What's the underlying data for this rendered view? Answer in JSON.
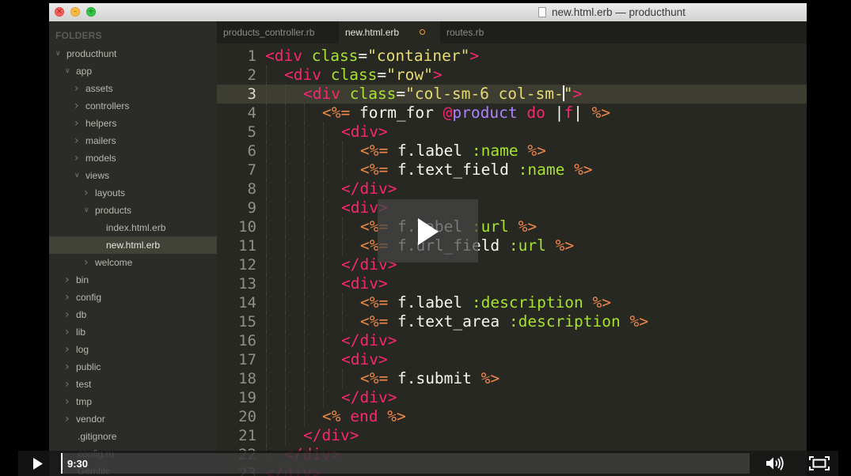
{
  "window": {
    "title": "new.html.erb — producthunt",
    "lights": [
      "×",
      "–",
      "+"
    ]
  },
  "sidebar": {
    "header": "FOLDERS",
    "items": [
      {
        "label": "producthunt",
        "depth": 0,
        "expander": "open"
      },
      {
        "label": "app",
        "depth": 1,
        "expander": "open"
      },
      {
        "label": "assets",
        "depth": 2,
        "expander": "closed"
      },
      {
        "label": "controllers",
        "depth": 2,
        "expander": "closed"
      },
      {
        "label": "helpers",
        "depth": 2,
        "expander": "closed"
      },
      {
        "label": "mailers",
        "depth": 2,
        "expander": "closed"
      },
      {
        "label": "models",
        "depth": 2,
        "expander": "closed"
      },
      {
        "label": "views",
        "depth": 2,
        "expander": "open"
      },
      {
        "label": "layouts",
        "depth": 3,
        "expander": "closed"
      },
      {
        "label": "products",
        "depth": 3,
        "expander": "open"
      },
      {
        "label": "index.html.erb",
        "depth": 4,
        "expander": "none"
      },
      {
        "label": "new.html.erb",
        "depth": 4,
        "expander": "none",
        "selected": true
      },
      {
        "label": "welcome",
        "depth": 3,
        "expander": "closed"
      },
      {
        "label": "bin",
        "depth": 1,
        "expander": "closed"
      },
      {
        "label": "config",
        "depth": 1,
        "expander": "closed"
      },
      {
        "label": "db",
        "depth": 1,
        "expander": "closed"
      },
      {
        "label": "lib",
        "depth": 1,
        "expander": "closed"
      },
      {
        "label": "log",
        "depth": 1,
        "expander": "closed"
      },
      {
        "label": "public",
        "depth": 1,
        "expander": "closed"
      },
      {
        "label": "test",
        "depth": 1,
        "expander": "closed"
      },
      {
        "label": "tmp",
        "depth": 1,
        "expander": "closed"
      },
      {
        "label": "vendor",
        "depth": 1,
        "expander": "closed"
      },
      {
        "label": ".gitignore",
        "depth": 1,
        "expander": "none"
      },
      {
        "label": "config.ru",
        "depth": 1,
        "expander": "none"
      },
      {
        "label": "Gemfile",
        "depth": 1,
        "expander": "none"
      }
    ]
  },
  "tabs": [
    {
      "label": "products_controller.rb",
      "active": false,
      "dirty": false
    },
    {
      "label": "new.html.erb",
      "active": true,
      "dirty": true
    },
    {
      "label": "routes.rb",
      "active": false,
      "dirty": false
    }
  ],
  "editor": {
    "current_line": 3,
    "cursor_line": 3,
    "lines": [
      {
        "n": "1",
        "indent": 0,
        "tokens": [
          [
            "t-tag",
            "<div"
          ],
          [
            "t-plain",
            " "
          ],
          [
            "t-attr",
            "class"
          ],
          [
            "t-plain",
            "="
          ],
          [
            "t-str",
            "\"container\""
          ],
          [
            "t-tag",
            ">"
          ]
        ]
      },
      {
        "n": "2",
        "indent": 1,
        "tokens": [
          [
            "t-tag",
            "<div"
          ],
          [
            "t-plain",
            " "
          ],
          [
            "t-attr",
            "class"
          ],
          [
            "t-plain",
            "="
          ],
          [
            "t-str",
            "\"row\""
          ],
          [
            "t-tag",
            ">"
          ]
        ]
      },
      {
        "n": "3",
        "indent": 2,
        "tokens": [
          [
            "t-tag",
            "<div"
          ],
          [
            "t-plain",
            " "
          ],
          [
            "t-attr",
            "class"
          ],
          [
            "t-plain",
            "="
          ],
          [
            "t-str",
            "\"col-sm-6 col-sm-"
          ],
          [
            "cursor",
            ""
          ],
          [
            "t-str",
            "\""
          ],
          [
            "t-tag",
            ">"
          ]
        ]
      },
      {
        "n": "4",
        "indent": 3,
        "tokens": [
          [
            "t-erb",
            "<%="
          ],
          [
            "t-plain",
            " "
          ],
          [
            "t-id",
            "form_for"
          ],
          [
            "t-plain",
            " "
          ],
          [
            "t-ivar",
            "@"
          ],
          [
            "t-sym",
            "product"
          ],
          [
            "t-plain",
            " "
          ],
          [
            "t-kw",
            "do"
          ],
          [
            "t-plain",
            " |"
          ],
          [
            "t-kw",
            "f"
          ],
          [
            "t-plain",
            "| "
          ],
          [
            "t-erb",
            "%>"
          ]
        ]
      },
      {
        "n": "5",
        "indent": 4,
        "tokens": [
          [
            "t-tag",
            "<div>"
          ]
        ]
      },
      {
        "n": "6",
        "indent": 5,
        "tokens": [
          [
            "t-erb",
            "<%="
          ],
          [
            "t-plain",
            " f.label "
          ],
          [
            "t-attr",
            ":name"
          ],
          [
            "t-plain",
            " "
          ],
          [
            "t-erb",
            "%>"
          ]
        ]
      },
      {
        "n": "7",
        "indent": 5,
        "tokens": [
          [
            "t-erb",
            "<%="
          ],
          [
            "t-plain",
            " f.text_field "
          ],
          [
            "t-attr",
            ":name"
          ],
          [
            "t-plain",
            " "
          ],
          [
            "t-erb",
            "%>"
          ]
        ]
      },
      {
        "n": "8",
        "indent": 4,
        "tokens": [
          [
            "t-tag",
            "</div>"
          ]
        ]
      },
      {
        "n": "9",
        "indent": 4,
        "tokens": [
          [
            "t-tag",
            "<div>"
          ]
        ]
      },
      {
        "n": "10",
        "indent": 5,
        "tokens": [
          [
            "t-erb",
            "<%="
          ],
          [
            "t-plain",
            " f.label "
          ],
          [
            "t-attr",
            ":url"
          ],
          [
            "t-plain",
            " "
          ],
          [
            "t-erb",
            "%>"
          ]
        ]
      },
      {
        "n": "11",
        "indent": 5,
        "tokens": [
          [
            "t-erb",
            "<%="
          ],
          [
            "t-plain",
            " f.url_field "
          ],
          [
            "t-attr",
            ":url"
          ],
          [
            "t-plain",
            " "
          ],
          [
            "t-erb",
            "%>"
          ]
        ]
      },
      {
        "n": "12",
        "indent": 4,
        "tokens": [
          [
            "t-tag",
            "</div>"
          ]
        ]
      },
      {
        "n": "13",
        "indent": 4,
        "tokens": [
          [
            "t-tag",
            "<div>"
          ]
        ]
      },
      {
        "n": "14",
        "indent": 5,
        "tokens": [
          [
            "t-erb",
            "<%="
          ],
          [
            "t-plain",
            " f.label "
          ],
          [
            "t-attr",
            ":description"
          ],
          [
            "t-plain",
            " "
          ],
          [
            "t-erb",
            "%>"
          ]
        ]
      },
      {
        "n": "15",
        "indent": 5,
        "tokens": [
          [
            "t-erb",
            "<%="
          ],
          [
            "t-plain",
            " f.text_area "
          ],
          [
            "t-attr",
            ":description"
          ],
          [
            "t-plain",
            " "
          ],
          [
            "t-erb",
            "%>"
          ]
        ]
      },
      {
        "n": "16",
        "indent": 4,
        "tokens": [
          [
            "t-tag",
            "</div>"
          ]
        ]
      },
      {
        "n": "17",
        "indent": 4,
        "tokens": [
          [
            "t-tag",
            "<div>"
          ]
        ]
      },
      {
        "n": "18",
        "indent": 5,
        "tokens": [
          [
            "t-erb",
            "<%="
          ],
          [
            "t-plain",
            " f.submit "
          ],
          [
            "t-erb",
            "%>"
          ]
        ]
      },
      {
        "n": "19",
        "indent": 4,
        "tokens": [
          [
            "t-tag",
            "</div>"
          ]
        ]
      },
      {
        "n": "20",
        "indent": 3,
        "tokens": [
          [
            "t-erb",
            "<%"
          ],
          [
            "t-plain",
            " "
          ],
          [
            "t-kw",
            "end"
          ],
          [
            "t-plain",
            " "
          ],
          [
            "t-erb",
            "%>"
          ]
        ]
      },
      {
        "n": "21",
        "indent": 2,
        "tokens": [
          [
            "t-tag",
            "</div>"
          ]
        ]
      },
      {
        "n": "22",
        "indent": 1,
        "tokens": [
          [
            "t-tag",
            "</div>"
          ]
        ]
      },
      {
        "n": "23",
        "indent": 0,
        "tokens": [
          [
            "t-tag",
            "</div>"
          ]
        ]
      }
    ]
  },
  "video": {
    "timecode": "9:30",
    "progress": 0.0,
    "play_icon": "play-icon",
    "volume_icon": "volume-icon",
    "fullscreen_icon": "fullscreen-icon"
  }
}
